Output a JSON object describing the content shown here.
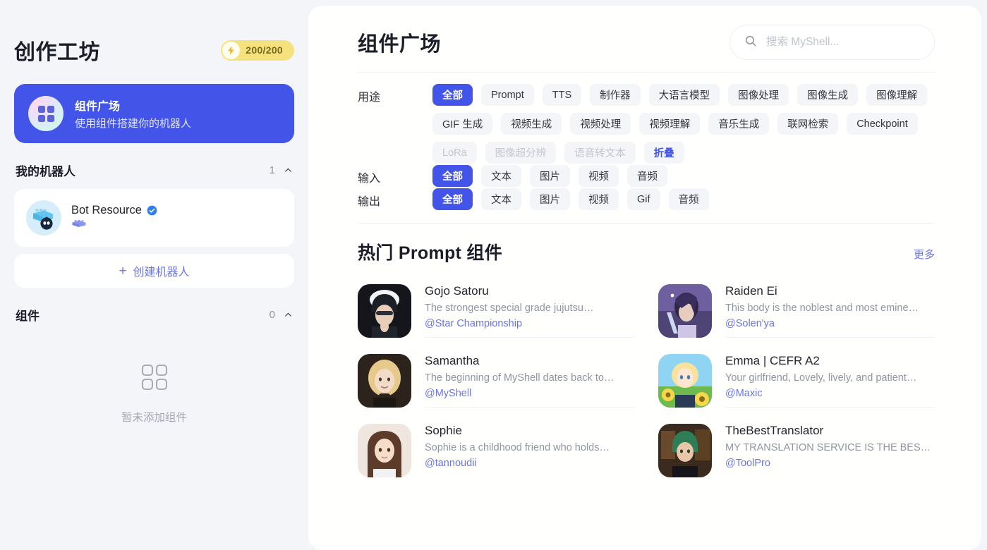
{
  "sidebar": {
    "title": "创作工坊",
    "credits": {
      "value": "200/200",
      "icon": "bolt-icon",
      "bg_color": "#f5e27e"
    },
    "feature_card": {
      "title": "组件广场",
      "subtitle": "使用组件搭建你的机器人",
      "icon": "grid-squares-icon",
      "bg_color": "#4355e8"
    },
    "my_bots": {
      "heading": "我的机器人",
      "count": "1",
      "collapse_icon": "chevron-up-icon",
      "bots": [
        {
          "name": "Bot Resource",
          "verified_icon": "verified-badge-icon",
          "tag_icon": "brick-icon"
        }
      ],
      "create_button": {
        "label": "创建机器人",
        "icon": "plus-icon"
      }
    },
    "components": {
      "heading": "组件",
      "count": "0",
      "collapse_icon": "chevron-up-icon",
      "empty_icon": "grid-outline-icon",
      "empty_text": "暂未添加组件"
    }
  },
  "main": {
    "page_title": "组件广场",
    "search": {
      "placeholder": "搜索 MyShell...",
      "value": "",
      "icon": "search-icon"
    },
    "filters": [
      {
        "label": "用途",
        "name": "purpose",
        "options": [
          {
            "text": "全部",
            "state": "active"
          },
          {
            "text": "Prompt",
            "state": "normal"
          },
          {
            "text": "TTS",
            "state": "normal"
          },
          {
            "text": "制作器",
            "state": "normal"
          },
          {
            "text": "大语言模型",
            "state": "normal"
          },
          {
            "text": "图像处理",
            "state": "normal"
          },
          {
            "text": "图像生成",
            "state": "normal"
          },
          {
            "text": "图像理解",
            "state": "normal"
          },
          {
            "text": "GIF 生成",
            "state": "normal"
          },
          {
            "text": "视频生成",
            "state": "normal"
          },
          {
            "text": "视频处理",
            "state": "normal"
          },
          {
            "text": "视频理解",
            "state": "normal"
          },
          {
            "text": "音乐生成",
            "state": "normal"
          },
          {
            "text": "联网检索",
            "state": "normal"
          },
          {
            "text": "Checkpoint",
            "state": "normal"
          },
          {
            "text": "LoRa",
            "state": "muted"
          },
          {
            "text": "图像超分辨",
            "state": "muted"
          },
          {
            "text": "语音转文本",
            "state": "muted"
          },
          {
            "text": "折叠",
            "state": "ghost"
          }
        ]
      },
      {
        "label": "输入",
        "name": "input",
        "options": [
          {
            "text": "全部",
            "state": "active"
          },
          {
            "text": "文本",
            "state": "normal"
          },
          {
            "text": "图片",
            "state": "normal"
          },
          {
            "text": "视频",
            "state": "normal"
          },
          {
            "text": "音频",
            "state": "normal"
          }
        ]
      },
      {
        "label": "输出",
        "name": "output",
        "options": [
          {
            "text": "全部",
            "state": "active"
          },
          {
            "text": "文本",
            "state": "normal"
          },
          {
            "text": "图片",
            "state": "normal"
          },
          {
            "text": "视频",
            "state": "normal"
          },
          {
            "text": "Gif",
            "state": "normal"
          },
          {
            "text": "音频",
            "state": "normal"
          }
        ]
      }
    ],
    "popular": {
      "title": "热门 Prompt 组件",
      "more_label": "更多",
      "cards": [
        {
          "name": "Gojo Satoru",
          "desc": "The strongest special grade jujutsu…",
          "author": "@Star Championship",
          "thumb": "gojo-satoru-thumb"
        },
        {
          "name": "Raiden Ei",
          "desc": "This body is the noblest and most emine…",
          "author": "@Solen'ya",
          "thumb": "raiden-ei-thumb"
        },
        {
          "name": "Samantha",
          "desc": "The beginning of MyShell dates back to…",
          "author": "@MyShell",
          "thumb": "samantha-thumb"
        },
        {
          "name": "Emma | CEFR A2",
          "desc": "Your girlfriend, Lovely, lively, and patient…",
          "author": "@Maxic",
          "thumb": "emma-cefr-thumb"
        },
        {
          "name": "Sophie",
          "desc": "Sophie is a childhood friend who holds…",
          "author": "@tannoudii",
          "thumb": "sophie-thumb"
        },
        {
          "name": "TheBestTranslator",
          "desc": "MY TRANSLATION SERVICE IS THE BES…",
          "author": "@ToolPro",
          "thumb": "thebesttranslator-thumb"
        }
      ]
    }
  },
  "colors": {
    "accent": "#4355e8",
    "link": "#6a74e8",
    "page_bg": "#f4f5f9",
    "panel_bg": "#ffffff",
    "chip_bg": "#f4f5f8",
    "muted_text": "#9095a2"
  }
}
